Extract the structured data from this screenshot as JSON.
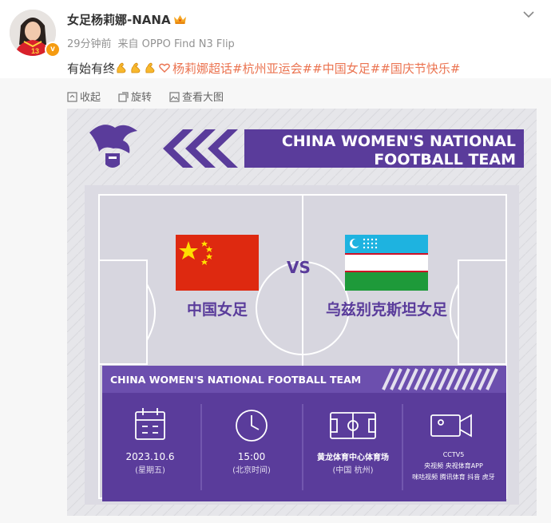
{
  "post": {
    "author": "女足杨莉娜-NANA",
    "time": "29分钟前",
    "source": "来自 OPPO Find N3 Flip",
    "text_prefix": "有始有终",
    "emoji_icons": [
      "flexed-biceps-icon",
      "flexed-biceps-icon",
      "flexed-biceps-icon",
      "heart-icon"
    ],
    "tags": [
      "杨莉娜超话",
      "#杭州亚运会#",
      "#中国女足#",
      "#国庆节快乐#"
    ],
    "avatar_jersey_number": "13"
  },
  "toolbar": {
    "collapse": "收起",
    "rotate": "旋转",
    "view_large": "查看大图"
  },
  "poster": {
    "banner_line1": "CHINA WOMEN'S NATIONAL",
    "banner_line2": "FOOTBALL TEAM",
    "vs": "VS",
    "home_team": "中国女足",
    "away_team": "乌兹别克斯坦女足",
    "info_header": "CHINA WOMEN'S NATIONAL FOOTBALL TEAM",
    "date": "2023.10.6",
    "weekday": "(星期五)",
    "time": "15:00",
    "timezone": "(北京时间)",
    "venue": "黄龙体育中心体育场",
    "city": "(中国 杭州)",
    "broadcast": [
      "CCTV5",
      "央视频 央视体育APP",
      "咪咕视频 腾讯体育 抖音 虎牙"
    ]
  },
  "colors": {
    "purple": "#5a3c9b",
    "tag_orange": "#eb7350",
    "china_red": "#de2910",
    "uzbek_blue": "#1eb3e0",
    "uzbek_green": "#1e9a3a"
  }
}
